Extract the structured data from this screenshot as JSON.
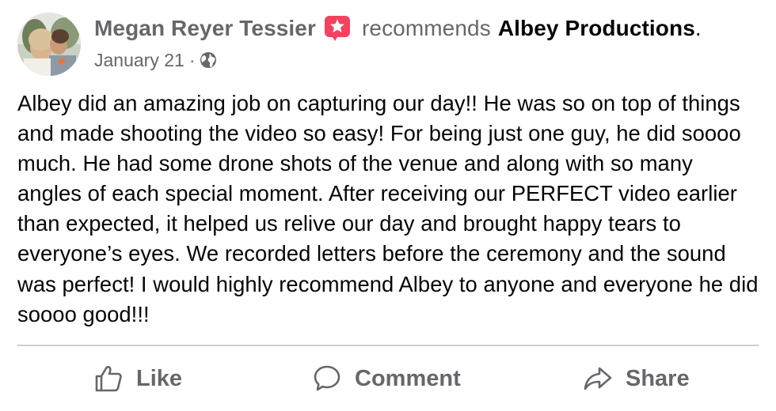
{
  "post": {
    "author": "Megan Reyer Tessier",
    "verb": "recommends",
    "page_name": "Albey Productions",
    "period": ".",
    "date": "January 21",
    "meta_separator": "·",
    "privacy_icon": "globe-icon",
    "recommend_icon": "recommend-star-icon",
    "body": "Albey did an amazing job on capturing our day!! He was so on top of things and made shooting the video so easy! For being just one guy, he did soooo much. He had some drone shots of the venue and along with so many angles of each special moment. After receiving our PERFECT video earlier than expected, it helped us relive our day and brought happy tears to everyone’s eyes. We recorded letters before the ceremony and the sound was perfect! I would highly recommend Albey to anyone and everyone he did soooo good!!!"
  },
  "actions": {
    "like": {
      "label": "Like",
      "icon": "thumbs-up-icon"
    },
    "comment": {
      "label": "Comment",
      "icon": "comment-icon"
    },
    "share": {
      "label": "Share",
      "icon": "share-arrow-icon"
    }
  },
  "colors": {
    "secondary_text": "#65676b",
    "primary_text": "#050505",
    "badge": "#f3425f",
    "divider": "#ced0d4"
  }
}
